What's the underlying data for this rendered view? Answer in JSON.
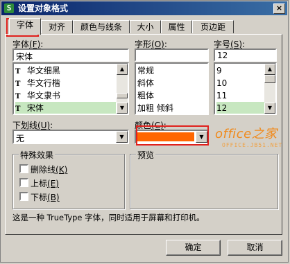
{
  "window": {
    "title": "设置对象格式",
    "app_icon_glyph": "S",
    "close_glyph": "×"
  },
  "tabs": [
    {
      "label": "字体"
    },
    {
      "label": "对齐"
    },
    {
      "label": "颜色与线条"
    },
    {
      "label": "大小"
    },
    {
      "label": "属性"
    },
    {
      "label": "页边距"
    }
  ],
  "font": {
    "label_prefix": "字体",
    "label_key": "(F)",
    "label_suffix": ":",
    "value": "宋体",
    "items": [
      "华文细黑",
      "华文行楷",
      "华文隶书",
      "宋体"
    ],
    "selected": "宋体"
  },
  "style": {
    "label_prefix": "字形",
    "label_key": "(O)",
    "label_suffix": ":",
    "value": "",
    "items": [
      "常规",
      "斜体",
      "粗体",
      "加粗 倾斜"
    ]
  },
  "size": {
    "label_prefix": "字号",
    "label_key": "(S)",
    "label_suffix": ":",
    "value": "12",
    "items": [
      "9",
      "10",
      "11",
      "12"
    ],
    "selected": "12"
  },
  "underline": {
    "label_prefix": "下划线",
    "label_key": "(U)",
    "label_suffix": ":",
    "value": "无"
  },
  "color": {
    "label_prefix": "颜色",
    "label_key": "(C)",
    "label_suffix": ":",
    "swatch": "#ff6600"
  },
  "effects": {
    "title": "特殊效果",
    "options": [
      {
        "label": "删除线",
        "key": "(K)"
      },
      {
        "label": "上标",
        "key": "(E)"
      },
      {
        "label": "下标",
        "key": "(B)"
      }
    ]
  },
  "preview": {
    "title": "预览"
  },
  "info_text": "这是一种 TrueType 字体，同时适用于屏幕和打印机。",
  "buttons": {
    "ok": "确定",
    "cancel": "取消"
  },
  "watermark": {
    "main": "office之家",
    "sub": "OFFICE.JB51.NET"
  },
  "highlight_color": "#e0201c",
  "scroll_arrows": {
    "up": "▲",
    "down": "▼"
  }
}
